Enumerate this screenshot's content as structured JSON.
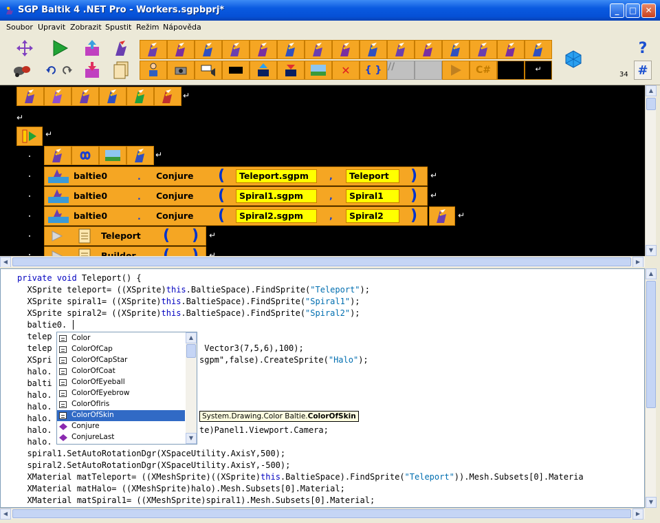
{
  "window": {
    "title": "SGP Baltik 4 .NET Pro - Workers.sgpbprj*",
    "min": "_",
    "max": "□",
    "close": "✕"
  },
  "menu": [
    "Soubor",
    "Upravit",
    "Zobrazit",
    "Spustit",
    "Režim",
    "Nápověda"
  ],
  "toolbar": {
    "help": "?",
    "hash": "#",
    "count": "34",
    "csharp": "C#",
    "slash": "//",
    "braces": "{ }",
    "return_glyph": "↵"
  },
  "visual": {
    "rows": [
      {
        "obj": "baltie0",
        "method": "Conjure",
        "arg1": "Teleport.sgpm",
        "arg2": "Teleport"
      },
      {
        "obj": "baltie0",
        "method": "Conjure",
        "arg1": "Spiral1.sgpm",
        "arg2": "Spiral1"
      },
      {
        "obj": "baltie0",
        "method": "Conjure",
        "arg1": "Spiral2.sgpm",
        "arg2": "Spiral2"
      }
    ],
    "calls": [
      "Teleport",
      "Builder"
    ],
    "comma": ",",
    "dot_sep": ".",
    "paren_open": "(",
    "paren_close": ")",
    "return_glyph": "↵"
  },
  "code": {
    "lines": [
      [
        "private void ",
        "Teleport() {"
      ],
      [
        "  XSprite teleport= ((XSprite)",
        "this",
        ".BaltieSpace).FindSprite(",
        "\"Teleport\"",
        ");"
      ],
      [
        "  XSprite spiral1= ((XSprite)",
        "this",
        ".BaltieSpace).FindSprite(",
        "\"Spiral1\"",
        ");"
      ],
      [
        "  XSprite spiral2= ((XSprite)",
        "this",
        ".BaltieSpace).FindSprite(",
        "\"Spiral2\"",
        ");"
      ],
      [
        "  baltie0."
      ],
      [
        "  telep"
      ],
      [
        "  telep"
      ],
      [
        "  XSpri"
      ],
      [
        "  halo."
      ],
      [
        "  balti"
      ],
      [
        "  halo."
      ],
      [
        "  halo."
      ],
      [
        "  halo."
      ],
      [
        "  halo."
      ],
      [
        "  halo."
      ],
      [
        "  spiral1.SetAutoRotationDgr(XSpaceUtility.AxisY,500);"
      ],
      [
        "  spiral2.SetAutoRotationDgr(XSpaceUtility.AxisY,-500);"
      ],
      [
        "  XMaterial matTeleport= ((XMeshSprite)((XSprite)",
        "this",
        ".BaltieSpace).FindSprite(",
        "\"Teleport\"",
        ")).Mesh.Subsets[0].Materia"
      ],
      [
        "  XMaterial matHalo= ((XMeshSprite)halo).Mesh.Subsets[0].Material;"
      ],
      [
        "  XMaterial matSpiral1= ((XMeshSprite)spiral1).Mesh.Subsets[0].Material;"
      ]
    ],
    "frag_vector": " Vector3(7,5,6),100);",
    "frag_sgpm1": "sgpm\",false).CreateSprite(",
    "frag_sgpm2": "\"Halo\"",
    "frag_sgpm3": ");",
    "frag_camera": "te)Panel1.Viewport.Camera;"
  },
  "autocomplete": {
    "items": [
      {
        "label": "Color",
        "kind": "property"
      },
      {
        "label": "ColorOfCap",
        "kind": "property"
      },
      {
        "label": "ColorOfCapStar",
        "kind": "property"
      },
      {
        "label": "ColorOfCoat",
        "kind": "property"
      },
      {
        "label": "ColorOfEyeball",
        "kind": "property"
      },
      {
        "label": "ColorOfEyebrow",
        "kind": "property"
      },
      {
        "label": "ColorOfIris",
        "kind": "property"
      },
      {
        "label": "ColorOfSkin",
        "kind": "property",
        "selected": true
      },
      {
        "label": "Conjure",
        "kind": "method"
      },
      {
        "label": "ConjureLast",
        "kind": "method"
      }
    ],
    "tooltip_prefix": "System.Drawing.Color Baltie.",
    "tooltip_name": "ColorOfSkin"
  },
  "colors": {
    "orange": "#f5a623",
    "yellow": "#ffff00",
    "keyword": "#0000c0",
    "string": "#006eb0",
    "selection": "#316ac5"
  }
}
